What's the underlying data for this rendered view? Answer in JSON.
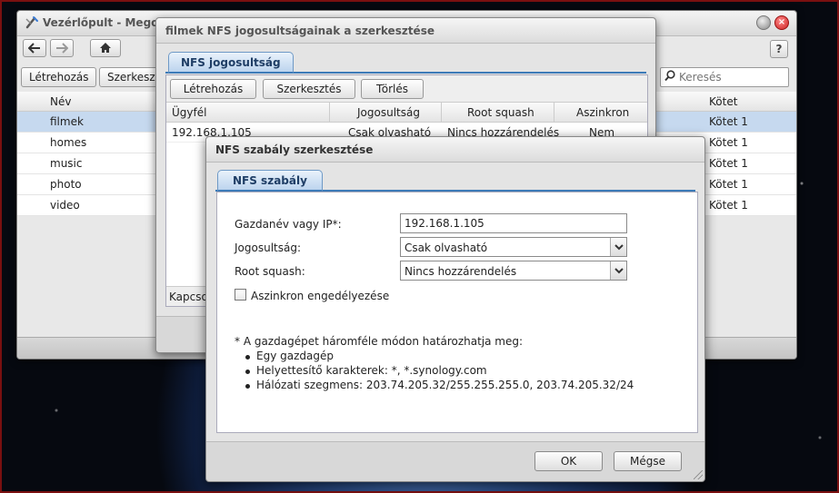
{
  "control_panel": {
    "title": "Vezérlőpult - Megosz",
    "help_label": "?",
    "toolbar": {
      "create_label": "Létrehozás",
      "edit_label": "Szerkeszté",
      "search_placeholder": "Keresés"
    },
    "grid": {
      "col_name": "Név",
      "col_volume": "Kötet",
      "rows": [
        {
          "name": "filmek",
          "volume": "Kötet 1",
          "selected": true
        },
        {
          "name": "homes",
          "volume": "Kötet 1"
        },
        {
          "name": "music",
          "volume": "Kötet 1"
        },
        {
          "name": "photo",
          "volume": "Kötet 1"
        },
        {
          "name": "video",
          "volume": "Kötet 1"
        }
      ]
    }
  },
  "nfs_dialog": {
    "title": "filmek NFS jogosultságainak a szerkesztése",
    "tab_label": "NFS jogosultság",
    "toolbar": {
      "create_label": "Létrehozás",
      "edit_label": "Szerkesztés",
      "delete_label": "Törlés"
    },
    "columns": [
      "Ügyfél",
      "Jogosultság",
      "Root squash",
      "Aszinkron"
    ],
    "rows": [
      {
        "client": "192.168.1.105",
        "permission": "Csak olvasható",
        "root_squash": "Nincs hozzárendelés",
        "async": "Nem"
      }
    ],
    "status_text": "Kapcso"
  },
  "rule_dialog": {
    "title": "NFS szabály szerkesztése",
    "tab_label": "NFS szabály",
    "host_label": "Gazdanév vagy IP*:",
    "host_value": "192.168.1.105",
    "permission_label": "Jogosultság:",
    "permission_value": "Csak olvasható",
    "root_squash_label": "Root squash:",
    "root_squash_value": "Nincs hozzárendelés",
    "async_label": "Aszinkron engedélyezése",
    "async_checked": false,
    "note_intro": "* A gazdagépet háromféle módon határozhatja meg:",
    "note_items": [
      "Egy gazdagép",
      "Helyettesítő karakterek: *, *.synology.com",
      "Hálózati szegmens: 203.74.205.32/255.255.255.0, 203.74.205.32/24"
    ],
    "ok_label": "OK",
    "cancel_label": "Mégse"
  }
}
